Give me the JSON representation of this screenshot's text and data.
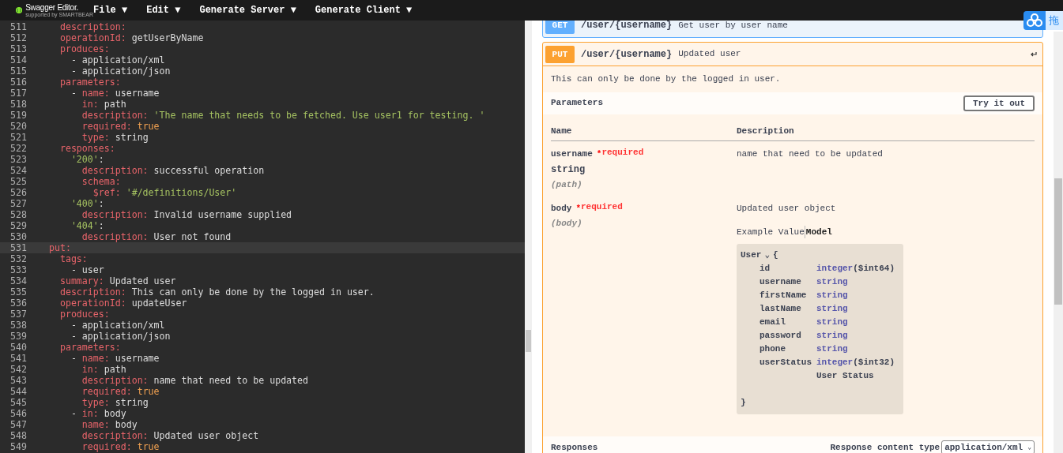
{
  "header": {
    "logo_text": "Swagger Editor.",
    "logo_subtext": "supported by SMARTBEAR",
    "menus": [
      {
        "label": "File",
        "caret": "▼"
      },
      {
        "label": "Edit",
        "caret": "▼"
      },
      {
        "label": "Generate Server",
        "caret": "▼"
      },
      {
        "label": "Generate Client",
        "caret": "▼"
      }
    ]
  },
  "editor": {
    "lines": [
      {
        "number": "511",
        "tokens": [
          {
            "text": "    description:",
            "kind": "key"
          }
        ]
      },
      {
        "number": "512",
        "tokens": [
          {
            "text": "    operationId:",
            "kind": "key"
          },
          {
            "text": " getUserByName",
            "kind": "plain"
          }
        ]
      },
      {
        "number": "513",
        "tokens": [
          {
            "text": "    produces:",
            "kind": "key"
          }
        ]
      },
      {
        "number": "514",
        "tokens": [
          {
            "text": "      - application/xml",
            "kind": "plain"
          }
        ]
      },
      {
        "number": "515",
        "tokens": [
          {
            "text": "      - application/json",
            "kind": "plain"
          }
        ]
      },
      {
        "number": "516",
        "tokens": [
          {
            "text": "    parameters:",
            "kind": "key"
          }
        ]
      },
      {
        "number": "517",
        "tokens": [
          {
            "text": "      - ",
            "kind": "plain"
          },
          {
            "text": "name:",
            "kind": "key"
          },
          {
            "text": " username",
            "kind": "plain"
          }
        ]
      },
      {
        "number": "518",
        "tokens": [
          {
            "text": "        in:",
            "kind": "key"
          },
          {
            "text": " path",
            "kind": "plain"
          }
        ]
      },
      {
        "number": "519",
        "tokens": [
          {
            "text": "        description:",
            "kind": "key"
          },
          {
            "text": " 'The name that needs to be fetched. Use user1 for testing. '",
            "kind": "string"
          }
        ]
      },
      {
        "number": "520",
        "tokens": [
          {
            "text": "        required:",
            "kind": "key"
          },
          {
            "text": " true",
            "kind": "bool"
          }
        ]
      },
      {
        "number": "521",
        "tokens": [
          {
            "text": "        type:",
            "kind": "key"
          },
          {
            "text": " string",
            "kind": "plain"
          }
        ]
      },
      {
        "number": "522",
        "tokens": [
          {
            "text": "    responses:",
            "kind": "key"
          }
        ]
      },
      {
        "number": "523",
        "tokens": [
          {
            "text": "      '200'",
            "kind": "string"
          },
          {
            "text": ":",
            "kind": "plain"
          }
        ]
      },
      {
        "number": "524",
        "tokens": [
          {
            "text": "        description:",
            "kind": "key"
          },
          {
            "text": " successful operation",
            "kind": "plain"
          }
        ]
      },
      {
        "number": "525",
        "tokens": [
          {
            "text": "        schema:",
            "kind": "key"
          }
        ]
      },
      {
        "number": "526",
        "tokens": [
          {
            "text": "          $ref:",
            "kind": "key"
          },
          {
            "text": " '#/definitions/User'",
            "kind": "string"
          }
        ]
      },
      {
        "number": "527",
        "tokens": [
          {
            "text": "      '400'",
            "kind": "string"
          },
          {
            "text": ":",
            "kind": "plain"
          }
        ]
      },
      {
        "number": "528",
        "tokens": [
          {
            "text": "        description:",
            "kind": "key"
          },
          {
            "text": " Invalid username supplied",
            "kind": "plain"
          }
        ]
      },
      {
        "number": "529",
        "tokens": [
          {
            "text": "      '404'",
            "kind": "string"
          },
          {
            "text": ":",
            "kind": "plain"
          }
        ]
      },
      {
        "number": "530",
        "tokens": [
          {
            "text": "        description:",
            "kind": "key"
          },
          {
            "text": " User not found",
            "kind": "plain"
          }
        ]
      },
      {
        "number": "531",
        "highlighted": true,
        "tokens": [
          {
            "text": "  put:",
            "kind": "key"
          }
        ]
      },
      {
        "number": "532",
        "tokens": [
          {
            "text": "    tags:",
            "kind": "key"
          }
        ]
      },
      {
        "number": "533",
        "tokens": [
          {
            "text": "      - user",
            "kind": "plain"
          }
        ]
      },
      {
        "number": "534",
        "tokens": [
          {
            "text": "    summary:",
            "kind": "key"
          },
          {
            "text": " Updated user",
            "kind": "plain"
          }
        ]
      },
      {
        "number": "535",
        "tokens": [
          {
            "text": "    description:",
            "kind": "key"
          },
          {
            "text": " This can only be done by the logged in user.",
            "kind": "plain"
          }
        ]
      },
      {
        "number": "536",
        "tokens": [
          {
            "text": "    operationId:",
            "kind": "key"
          },
          {
            "text": " updateUser",
            "kind": "plain"
          }
        ]
      },
      {
        "number": "537",
        "tokens": [
          {
            "text": "    produces:",
            "kind": "key"
          }
        ]
      },
      {
        "number": "538",
        "tokens": [
          {
            "text": "      - application/xml",
            "kind": "plain"
          }
        ]
      },
      {
        "number": "539",
        "tokens": [
          {
            "text": "      - application/json",
            "kind": "plain"
          }
        ]
      },
      {
        "number": "540",
        "tokens": [
          {
            "text": "    parameters:",
            "kind": "key"
          }
        ]
      },
      {
        "number": "541",
        "tokens": [
          {
            "text": "      - ",
            "kind": "plain"
          },
          {
            "text": "name:",
            "kind": "key"
          },
          {
            "text": " username",
            "kind": "plain"
          }
        ]
      },
      {
        "number": "542",
        "tokens": [
          {
            "text": "        in:",
            "kind": "key"
          },
          {
            "text": " path",
            "kind": "plain"
          }
        ]
      },
      {
        "number": "543",
        "tokens": [
          {
            "text": "        description:",
            "kind": "key"
          },
          {
            "text": " name that need to be updated",
            "kind": "plain"
          }
        ]
      },
      {
        "number": "544",
        "tokens": [
          {
            "text": "        required:",
            "kind": "key"
          },
          {
            "text": " true",
            "kind": "bool"
          }
        ]
      },
      {
        "number": "545",
        "tokens": [
          {
            "text": "        type:",
            "kind": "key"
          },
          {
            "text": " string",
            "kind": "plain"
          }
        ]
      },
      {
        "number": "546",
        "tokens": [
          {
            "text": "      - ",
            "kind": "plain"
          },
          {
            "text": "in:",
            "kind": "key"
          },
          {
            "text": " body",
            "kind": "plain"
          }
        ]
      },
      {
        "number": "547",
        "tokens": [
          {
            "text": "        name:",
            "kind": "key"
          },
          {
            "text": " body",
            "kind": "plain"
          }
        ]
      },
      {
        "number": "548",
        "tokens": [
          {
            "text": "        description:",
            "kind": "key"
          },
          {
            "text": " Updated user object",
            "kind": "plain"
          }
        ]
      },
      {
        "number": "549",
        "tokens": [
          {
            "text": "        required:",
            "kind": "key"
          },
          {
            "text": " true",
            "kind": "bool"
          }
        ]
      }
    ]
  },
  "operations": [
    {
      "method": "GET",
      "path": "/user/{username}",
      "summary": "Get user by user name",
      "expanded": false
    },
    {
      "method": "PUT",
      "path": "/user/{username}",
      "summary": "Updated user",
      "expanded": true,
      "description": "This can only be done by the logged in user.",
      "parameters_title": "Parameters",
      "try_button": "Try it out",
      "columns": [
        "Name",
        "Description"
      ],
      "parameters": [
        {
          "name": "username",
          "required_mark": "*",
          "required_label": "required",
          "type": "string",
          "location": "(path)",
          "description": "name that need to be updated"
        },
        {
          "name": "body",
          "required_mark": "*",
          "required_label": "required",
          "location": "(body)",
          "description": "Updated user object",
          "model_tabs": [
            {
              "label": "Example Value",
              "selected": false
            },
            {
              "label": "Model",
              "selected": true
            }
          ],
          "model": {
            "name": "User",
            "toggle": "⌄",
            "open": "{",
            "close": "}",
            "fields": [
              {
                "name": "id",
                "type": "integer",
                "format": "($int64)"
              },
              {
                "name": "username",
                "type": "string"
              },
              {
                "name": "firstName",
                "type": "string"
              },
              {
                "name": "lastName",
                "type": "string"
              },
              {
                "name": "email",
                "type": "string"
              },
              {
                "name": "password",
                "type": "string"
              },
              {
                "name": "phone",
                "type": "string"
              },
              {
                "name": "userStatus",
                "type": "integer",
                "format": "($int32)",
                "description": "User Status"
              }
            ]
          }
        }
      ],
      "responses_title": "Responses",
      "content_type_label": "Response content type",
      "content_type": "application/xml",
      "content_type_caret": "⌄"
    }
  ],
  "widget": {
    "label": "拖"
  }
}
